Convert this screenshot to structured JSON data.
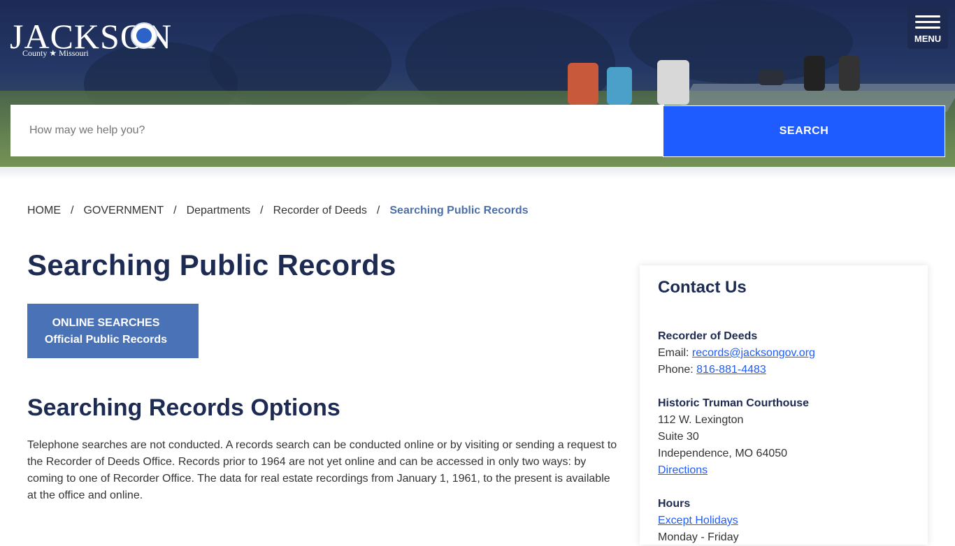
{
  "header": {
    "logo_title": "JACKSON",
    "logo_subtitle": "County ★ Missouri",
    "menu_label": "MENU",
    "search_placeholder": "How may we help you?",
    "search_button": "SEARCH"
  },
  "breadcrumb": {
    "items": [
      "HOME",
      "GOVERNMENT",
      "Departments",
      "Recorder of Deeds"
    ],
    "separator": "/",
    "current": "Searching Public Records"
  },
  "main": {
    "title": "Searching Public Records",
    "online_button": {
      "line1": "ONLINE SEARCHES",
      "line2": "Official Public Records",
      "chevron": "›"
    },
    "section_title": "Searching Records Options",
    "body": "Telephone searches are not conducted. A records search can be conducted online or by visiting or sending a request to the Recorder of Deeds Office. Records prior to 1964 are not yet online and can be accessed in only two ways: by coming to one of Recorder Office. The data for real estate recordings from January 1, 1961, to the present is available at the office and online."
  },
  "contact": {
    "title": "Contact Us",
    "office_name": "Recorder of Deeds",
    "email_label": "Email: ",
    "email": "records@jacksongov.org",
    "phone_label": "Phone: ",
    "phone": "816-881-4483",
    "location_name": "Historic Truman Courthouse",
    "address1": "112 W. Lexington",
    "address2": "Suite 30",
    "address3": "Independence, MO 64050",
    "directions": "Directions",
    "hours_title": "Hours",
    "hours_link": "Except Holidays",
    "hours_days": "Monday - Friday"
  },
  "colors": {
    "navy": "#1d2a52",
    "search_blue": "#1e5cff",
    "button_blue": "#4a73b7",
    "breadcrumb_current": "#4b6fa8"
  }
}
